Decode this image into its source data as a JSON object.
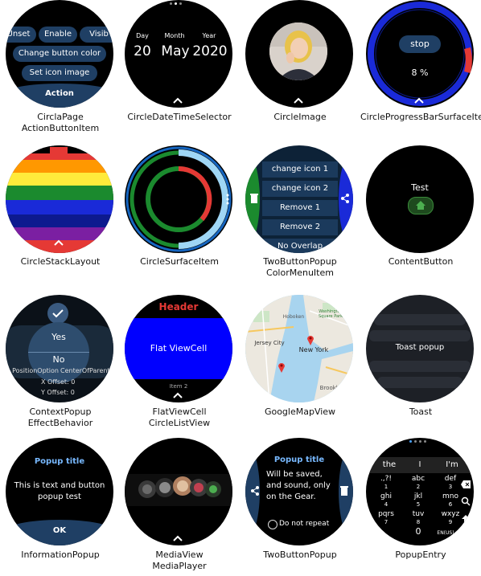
{
  "grid": [
    {
      "caption": [
        "CirclaPage",
        "ActionButtonItem"
      ]
    },
    {
      "caption": [
        "CircleDateTimeSelector"
      ]
    },
    {
      "caption": [
        "CircleImage"
      ]
    },
    {
      "caption": [
        "CircleProgressBarSurfaceItem"
      ]
    },
    {
      "caption": [
        "CircleStackLayout"
      ]
    },
    {
      "caption": [
        "CircleSurfaceItem"
      ]
    },
    {
      "caption": [
        "TwoButtonPopup",
        "ColorMenuItem"
      ]
    },
    {
      "caption": [
        "ContentButton"
      ]
    },
    {
      "caption": [
        "ContextPopup",
        "EffectBehavior"
      ]
    },
    {
      "caption": [
        "FlatViewCell",
        "CircleListView"
      ]
    },
    {
      "caption": [
        "GoogleMapView"
      ]
    },
    {
      "caption": [
        "Toast"
      ]
    },
    {
      "caption": [
        "InformationPopup"
      ]
    },
    {
      "caption": [
        "MediaView",
        "MediaPlayer"
      ]
    },
    {
      "caption": [
        "TwoButtonPopup"
      ]
    },
    {
      "caption": [
        "PopupEntry"
      ]
    }
  ],
  "w1": {
    "chips": [
      "Unset",
      "Enable",
      "Visib"
    ],
    "btn1": "Change button color",
    "btn2": "Set icon image",
    "action": "Action"
  },
  "w2": {
    "labels": [
      "Day",
      "Month",
      "Year"
    ],
    "values": [
      "20",
      "May",
      "2020"
    ]
  },
  "w4": {
    "button": "stop",
    "percent": "8 %",
    "progress": 0.08
  },
  "w7": {
    "items": [
      "change icon 1",
      "change icon 2",
      "Remove 1",
      "Remove 2",
      "No Overlap"
    ]
  },
  "w8": {
    "label": "Test"
  },
  "w9": {
    "yes": "Yes",
    "no": "No",
    "info1": "PositionOption",
    "info2": "CenterOfParent",
    "xoff": "X Offset:  0",
    "yoff": "Y Offset:  0"
  },
  "w10": {
    "header": "Header",
    "cell": "Flat ViewCell",
    "item": "Item 2"
  },
  "w11": {
    "labels": [
      "Jersey City",
      "New York",
      "Hoboken",
      "Washington Square Park",
      "Brooklyn"
    ]
  },
  "w12": {
    "toast": "Toast popup"
  },
  "w13": {
    "title": "Popup title",
    "text": [
      "This is text and button",
      "popup test"
    ],
    "ok": "OK"
  },
  "w15": {
    "title": "Popup title",
    "text": [
      "Will be saved,",
      "and sound, only",
      "on the Gear."
    ],
    "check": "Do not repeat"
  },
  "w16": {
    "suggest": [
      "the",
      "I",
      "I'm"
    ],
    "keys": [
      [
        ".,?!",
        "1"
      ],
      [
        "abc",
        "2"
      ],
      [
        "def",
        "3"
      ],
      [
        "ghi",
        "4"
      ],
      [
        "jkl",
        "5"
      ],
      [
        "mno",
        "6"
      ],
      [
        "pqrs",
        "7"
      ],
      [
        "tuv",
        "8"
      ],
      [
        "wxyz",
        "9"
      ]
    ],
    "zero": "0",
    "lang": "EN(US)"
  },
  "colors": {
    "accent": "#1f3f64",
    "blue": "#0000ff",
    "green": "#2e7d32",
    "red": "#e53935",
    "popupBlue": "#78b9ff"
  }
}
